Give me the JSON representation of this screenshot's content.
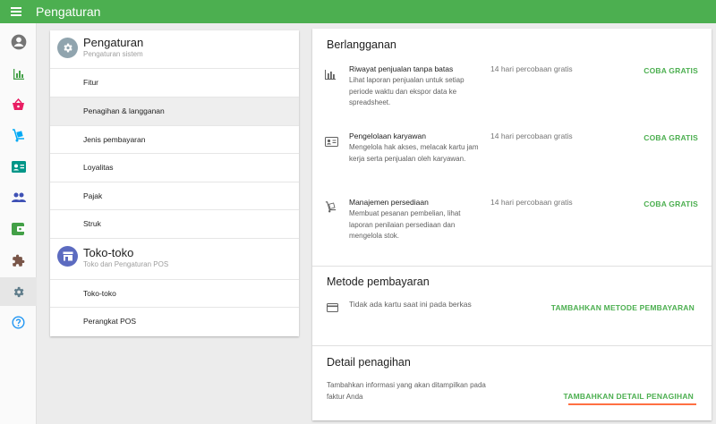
{
  "appbar": {
    "title": "Pengaturan",
    "menu_icon": "menu-icon"
  },
  "rail": [
    {
      "icon": "account-icon",
      "color": "#757575"
    },
    {
      "icon": "bar-chart-icon",
      "color": "#43a047"
    },
    {
      "icon": "basket-icon",
      "color": "#e91e63"
    },
    {
      "icon": "dolly-icon",
      "color": "#03a9f4"
    },
    {
      "icon": "badge-icon",
      "color": "#009688"
    },
    {
      "icon": "people-icon",
      "color": "#3f51b5"
    },
    {
      "icon": "wallet-icon",
      "color": "#43a047"
    },
    {
      "icon": "puzzle-icon",
      "color": "#795548"
    },
    {
      "icon": "settings-icon",
      "color": "#607d8b",
      "active": true
    },
    {
      "icon": "help-icon",
      "color": "#2196f3"
    }
  ],
  "left": {
    "sections": [
      {
        "title": "Pengaturan",
        "subtitle": "Pengaturan sistem",
        "icon": "gear-icon",
        "items": [
          "Fitur",
          "Penagihan & langganan",
          "Jenis pembayaran",
          "Loyalitas",
          "Pajak",
          "Struk"
        ]
      },
      {
        "title": "Toko-toko",
        "subtitle": "Toko dan Pengaturan POS",
        "icon": "store-icon",
        "items": [
          "Toko-toko",
          "Perangkat POS"
        ]
      }
    ],
    "active_item": "Penagihan & langganan"
  },
  "subscription": {
    "heading": "Berlangganan",
    "features": [
      {
        "title": "Riwayat penjualan tanpa batas",
        "desc": "Lihat laporan penjualan untuk setiap periode waktu dan ekspor data ke spreadsheet.",
        "trial": "14 hari percobaan gratis",
        "button": "COBA GRATIS",
        "icon": "bar-chart-icon"
      },
      {
        "title": "Pengelolaan karyawan",
        "desc": "Mengelola hak akses, melacak kartu jam kerja serta penjualan oleh karyawan.",
        "trial": "14 hari percobaan gratis",
        "button": "COBA GRATIS",
        "icon": "employee-card-icon"
      },
      {
        "title": "Manajemen persediaan",
        "desc": "Membuat pesanan pembelian, lihat laporan penilaian persediaan dan mengelola stok.",
        "trial": "14 hari percobaan gratis",
        "button": "COBA GRATIS",
        "icon": "dolly-icon"
      }
    ]
  },
  "payment": {
    "heading": "Metode pembayaran",
    "empty_text": "Tidak ada kartu saat ini pada berkas",
    "button": "TAMBAHKAN METODE PEMBAYARAN",
    "icon": "credit-card-icon"
  },
  "billing": {
    "heading": "Detail penagihan",
    "text": "Tambahkan informasi yang akan ditampilkan pada faktur Anda",
    "button": "TAMBAHKAN DETAIL PENAGIHAN",
    "underline_color": "#ff7043"
  },
  "colors": {
    "appbar": "#4caf50",
    "accent": "#4caf50"
  }
}
